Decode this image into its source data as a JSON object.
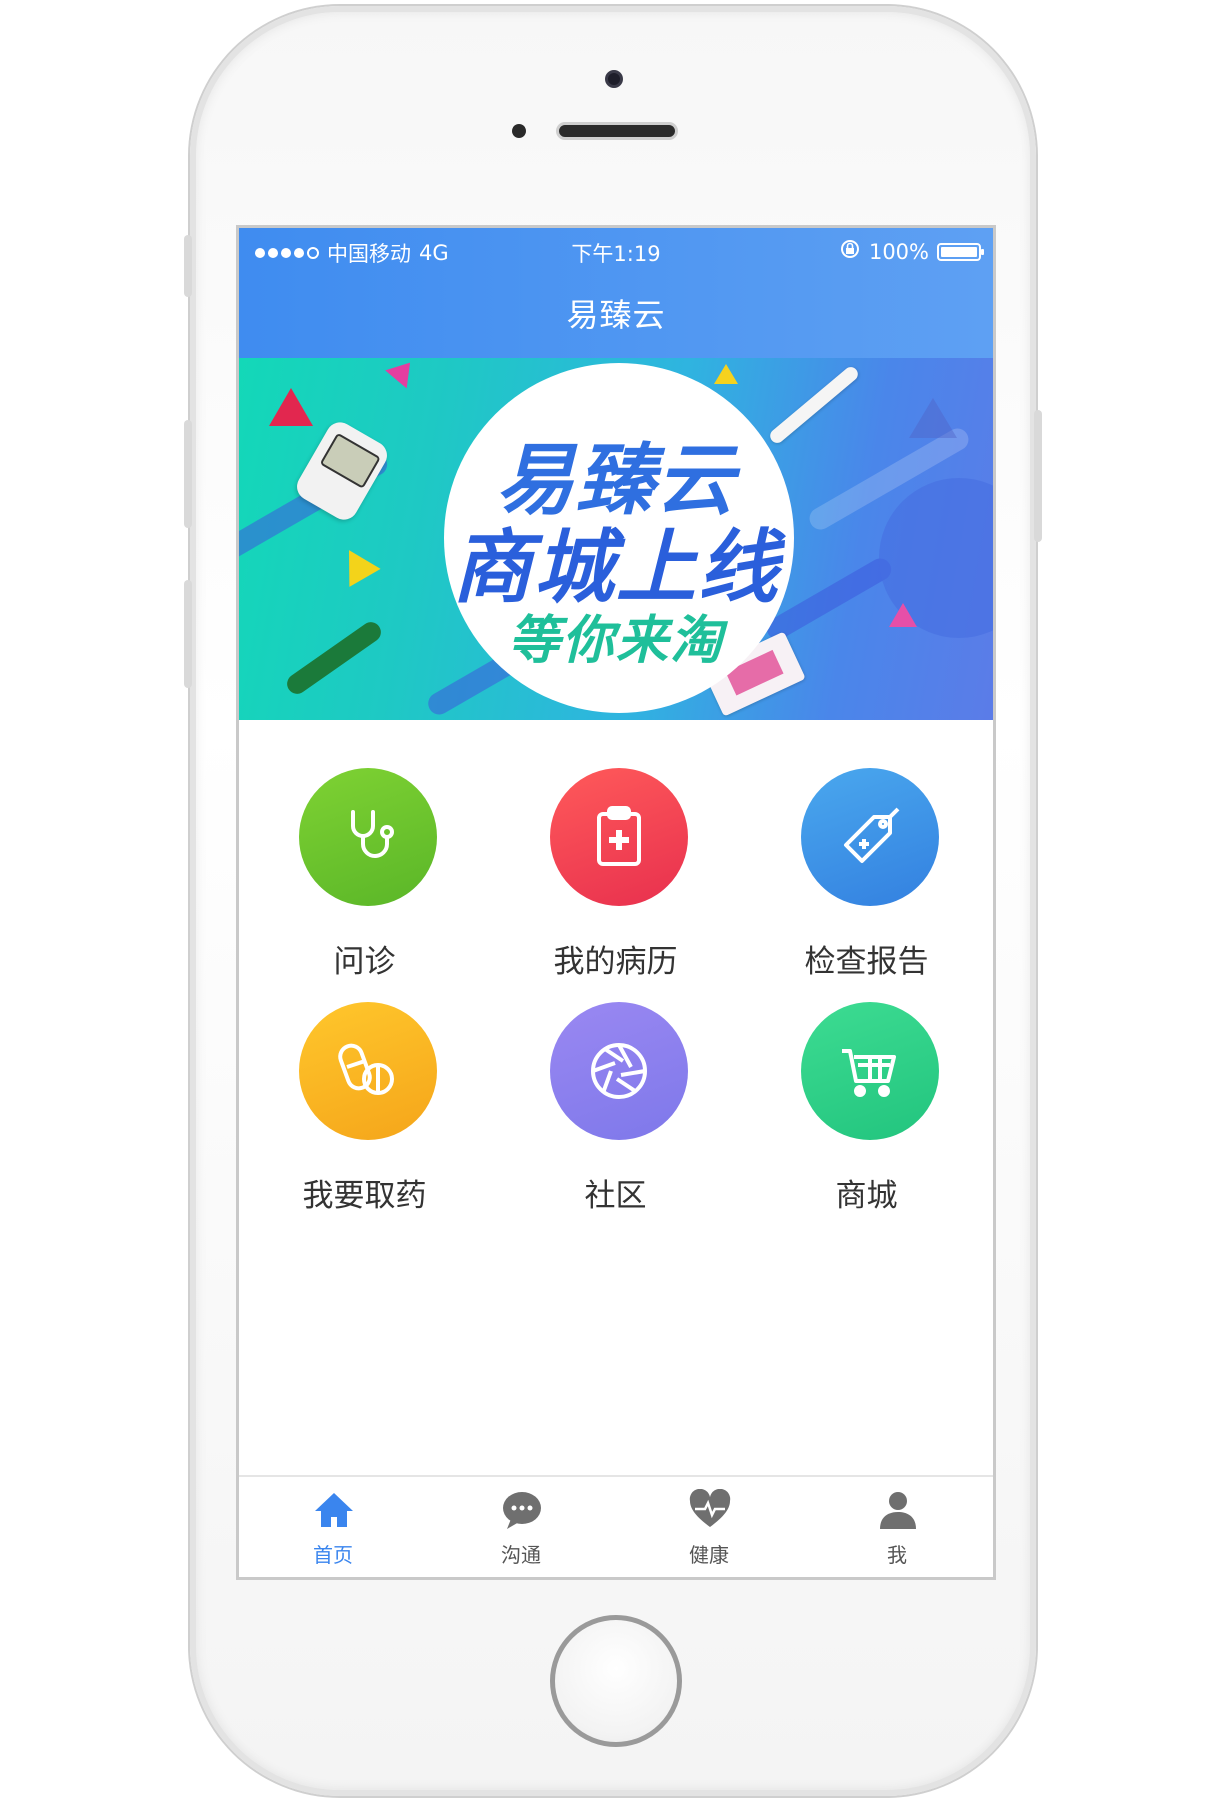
{
  "status_bar": {
    "carrier": "中国移动",
    "network": "4G",
    "time": "下午1:19",
    "battery": "100%"
  },
  "header": {
    "title": "易臻云"
  },
  "banner": {
    "line1": "易臻云",
    "line2": "商城上线",
    "line3": "等你来淘"
  },
  "grid": {
    "items": [
      {
        "label": "问诊",
        "icon": "stethoscope-icon",
        "color": "#6cc429"
      },
      {
        "label": "我的病历",
        "icon": "clipboard-icon",
        "color": "#f1464f"
      },
      {
        "label": "检查报告",
        "icon": "tag-icon",
        "color": "#3a92e6"
      },
      {
        "label": "我要取药",
        "icon": "pills-icon",
        "color": "#fbb81f"
      },
      {
        "label": "社区",
        "icon": "aperture-icon",
        "color": "#8b7fee"
      },
      {
        "label": "商城",
        "icon": "cart-icon",
        "color": "#30cf8a"
      }
    ]
  },
  "tabbar": {
    "tabs": [
      {
        "label": "首页",
        "icon": "home-icon",
        "active": true
      },
      {
        "label": "沟通",
        "icon": "chat-icon",
        "active": false
      },
      {
        "label": "健康",
        "icon": "heart-pulse-icon",
        "active": false
      },
      {
        "label": "我",
        "icon": "user-icon",
        "active": false
      }
    ]
  },
  "colors": {
    "header": "#4a93f0",
    "tab_active": "#3a85ee",
    "tab_inactive": "#6f6f6f"
  }
}
